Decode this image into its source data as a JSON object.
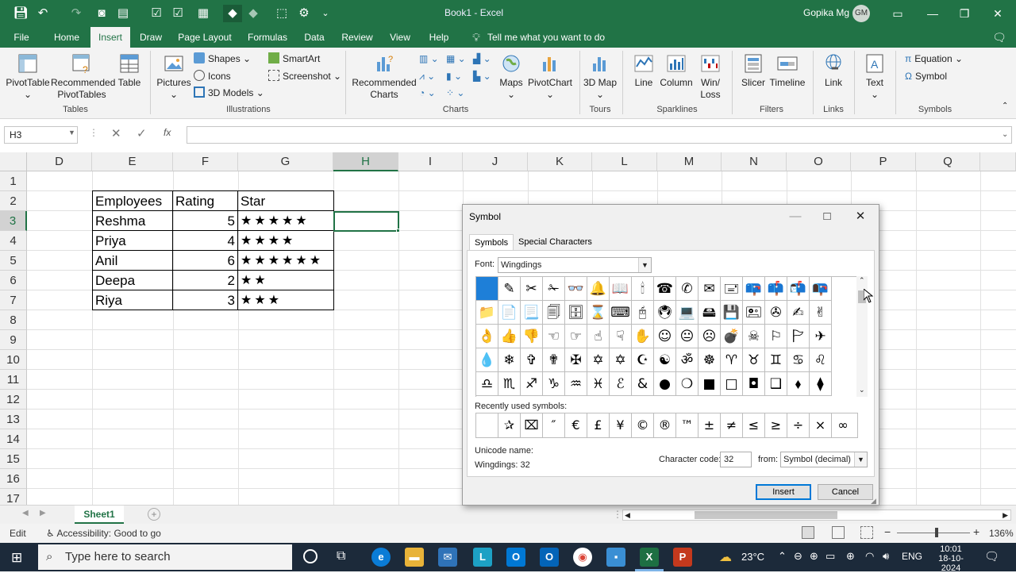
{
  "title_bar": {
    "document_title": "Book1  -  Excel",
    "user_name": "Gopika Mg",
    "user_initials": "GM"
  },
  "menu": {
    "tabs": [
      "File",
      "Home",
      "Insert",
      "Draw",
      "Page Layout",
      "Formulas",
      "Data",
      "Review",
      "View",
      "Help"
    ],
    "active_tab": "Insert",
    "tell_me": "Tell me what you want to do"
  },
  "ribbon": {
    "tables": {
      "pivot": "PivotTable",
      "recommended_pivot": "Recommended PivotTables",
      "table": "Table",
      "label": "Tables"
    },
    "illustrations": {
      "pictures": "Pictures",
      "shapes": "Shapes",
      "icons": "Icons",
      "models": "3D Models",
      "smartart": "SmartArt",
      "screenshot": "Screenshot",
      "label": "Illustrations"
    },
    "charts": {
      "recommended": "Recommended Charts",
      "maps": "Maps",
      "pivotchart": "PivotChart",
      "label": "Charts"
    },
    "tours": {
      "map3d": "3D Map",
      "label": "Tours"
    },
    "sparklines": {
      "line": "Line",
      "column": "Column",
      "winloss": "Win/ Loss",
      "label": "Sparklines"
    },
    "filters": {
      "slicer": "Slicer",
      "timeline": "Timeline",
      "label": "Filters"
    },
    "links": {
      "link": "Link",
      "label": "Links"
    },
    "text": {
      "text": "Text"
    },
    "symbols": {
      "equation": "Equation",
      "symbol": "Symbol",
      "label": "Symbols"
    }
  },
  "formula_bar": {
    "name_box": "H3",
    "fx": "fx",
    "formula": ""
  },
  "sheet": {
    "columns": [
      "D",
      "E",
      "F",
      "G",
      "H",
      "I",
      "J",
      "K",
      "L",
      "M",
      "N",
      "O",
      "P",
      "Q"
    ],
    "rows": [
      "1",
      "2",
      "3",
      "4",
      "5",
      "6",
      "7",
      "8",
      "9",
      "10",
      "11",
      "12",
      "13",
      "14",
      "15",
      "16",
      "17"
    ],
    "selected_cell": "H3",
    "header": [
      "Employees",
      "Rating",
      "Star"
    ],
    "data": [
      {
        "name": "Reshma",
        "rating": "5",
        "star": "★★★★★"
      },
      {
        "name": "Priya",
        "rating": "4",
        "star": "★★★★"
      },
      {
        "name": "Anil",
        "rating": "6",
        "star": "★★★★★★"
      },
      {
        "name": "Deepa",
        "rating": "2",
        "star": "★★"
      },
      {
        "name": "Riya",
        "rating": "3",
        "star": "★★★"
      }
    ]
  },
  "sheet_tabs": {
    "active": "Sheet1"
  },
  "status_bar": {
    "mode": "Edit",
    "accessibility": "Accessibility: Good to go",
    "zoom": "136%"
  },
  "taskbar": {
    "search_placeholder": "Type here to search",
    "weather": "23°C",
    "language": "ENG",
    "time": "10:01",
    "date": "18-10-2024"
  },
  "symbol_dialog": {
    "title": "Symbol",
    "tabs": [
      "Symbols",
      "Special Characters"
    ],
    "font_label": "Font:",
    "font_value": "Wingdings",
    "symbols": [
      [
        "",
        "✎",
        "✂",
        "✁",
        "👓",
        "🔔",
        "📖",
        "🕯",
        "☎",
        "✆",
        "✉",
        "🖃",
        "📪",
        "📫",
        "📬",
        "📭"
      ],
      [
        "📁",
        "📄",
        "📃",
        "🗐",
        "🗄",
        "⌛",
        "⌨",
        "🖰",
        "🖲",
        "💻",
        "🖴",
        "💾",
        "🖭",
        "✇",
        "✍",
        "✌"
      ],
      [
        "👌",
        "👍",
        "👎",
        "☜",
        "☞",
        "☝",
        "☟",
        "✋",
        "☺",
        "😐",
        "☹",
        "💣",
        "☠",
        "⚐",
        "🏱",
        "✈"
      ],
      [
        "💧",
        "❄",
        "✞",
        "✟",
        "✠",
        "✡",
        "✡",
        "☪",
        "☯",
        "ॐ",
        "☸",
        "♈",
        "♉",
        "♊",
        "♋",
        "♌"
      ],
      [
        "♎",
        "♏",
        "♐",
        "♑",
        "♒",
        "♓",
        "ℰ",
        "&",
        "●",
        "❍",
        "■",
        "□",
        "◘",
        "❑",
        "⬧",
        "⧫"
      ]
    ],
    "recent_label": "Recently used symbols:",
    "recent": [
      "",
      "✰",
      "⌧",
      "″",
      "€",
      "£",
      "¥",
      "©",
      "®",
      "™",
      "±",
      "≠",
      "≤",
      "≥",
      "÷",
      "×",
      "∞"
    ],
    "unicode_name_label": "Unicode name:",
    "unicode_name_value": "Wingdings: 32",
    "char_code_label": "Character code:",
    "char_code_value": "32",
    "from_label": "from:",
    "from_value": "Symbol (decimal)",
    "insert_button": "Insert",
    "cancel_button": "Cancel"
  }
}
